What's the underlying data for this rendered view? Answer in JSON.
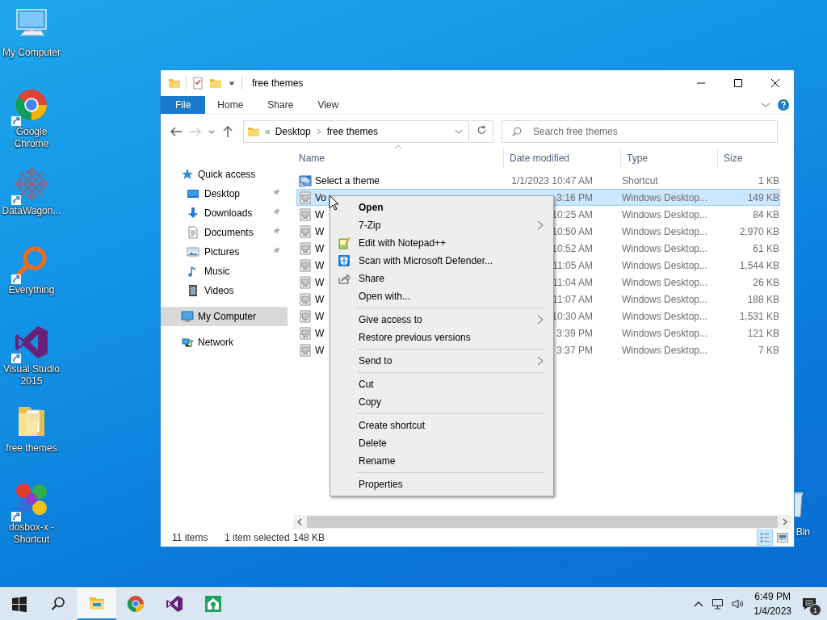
{
  "desktop_icons": [
    {
      "label": "My Computer",
      "kind": "computer",
      "shortcut": false
    },
    {
      "label": "Google Chrome",
      "kind": "chrome",
      "shortcut": true
    },
    {
      "label": "DataWagon...",
      "kind": "datawagon",
      "shortcut": true
    },
    {
      "label": "Everything",
      "kind": "everything",
      "shortcut": true
    },
    {
      "label": "Visual Studio 2015",
      "kind": "vs",
      "shortcut": true
    },
    {
      "label": "free themes",
      "kind": "themes_folder",
      "shortcut": false
    },
    {
      "label": "dosbox-x - Shortcut",
      "kind": "dosbox",
      "shortcut": true
    }
  ],
  "recycle_bin": {
    "label": "Bin"
  },
  "window": {
    "title": "free themes",
    "ribbon_tabs": [
      {
        "label": "File",
        "selected": true
      },
      {
        "label": "Home",
        "selected": false
      },
      {
        "label": "Share",
        "selected": false
      },
      {
        "label": "View",
        "selected": false
      }
    ],
    "address": {
      "overflow": "«",
      "breadcrumb": [
        "Desktop",
        "free themes"
      ]
    },
    "search": {
      "placeholder": "Search free themes"
    },
    "nav_pane": [
      {
        "label": "Quick access",
        "kind": "star",
        "selected": false,
        "children": [
          {
            "label": "Desktop",
            "kind": "desktop",
            "pinned": true,
            "selected": false
          },
          {
            "label": "Downloads",
            "kind": "download",
            "pinned": true,
            "selected": false
          },
          {
            "label": "Documents",
            "kind": "document",
            "pinned": true,
            "selected": false
          },
          {
            "label": "Pictures",
            "kind": "pictures",
            "pinned": true,
            "selected": false
          },
          {
            "label": "Music",
            "kind": "music",
            "pinned": false,
            "selected": false
          },
          {
            "label": "Videos",
            "kind": "videos",
            "pinned": false,
            "selected": false
          }
        ]
      },
      {
        "label": "My Computer",
        "kind": "computer",
        "selected": true
      },
      {
        "label": "Network",
        "kind": "network",
        "selected": false
      }
    ],
    "columns": [
      {
        "label": "Name",
        "sorted": true
      },
      {
        "label": "Date modified",
        "sorted": false
      },
      {
        "label": "Type",
        "sorted": false
      },
      {
        "label": "Size",
        "sorted": false
      }
    ],
    "rows": [
      {
        "kind": "shortcut",
        "name": "Select a theme",
        "date": "1/1/2023 10:47 AM",
        "type": "Shortcut",
        "size": "1 KB",
        "selected": false
      },
      {
        "kind": "theme",
        "name": "Vo",
        "date": "3:16 PM",
        "type": "Windows Desktop...",
        "size": "149 KB",
        "selected": true
      },
      {
        "kind": "theme",
        "name": "W",
        "date": "10:25 AM",
        "type": "Windows Desktop...",
        "size": "84 KB",
        "selected": false
      },
      {
        "kind": "theme",
        "name": "W",
        "date": "10:50 AM",
        "type": "Windows Desktop...",
        "size": "2,970 KB",
        "selected": false
      },
      {
        "kind": "theme",
        "name": "W",
        "date": "10:52 AM",
        "type": "Windows Desktop...",
        "size": "61 KB",
        "selected": false
      },
      {
        "kind": "theme",
        "name": "W",
        "date": "11:05 AM",
        "type": "Windows Desktop...",
        "size": "1,544 KB",
        "selected": false
      },
      {
        "kind": "theme",
        "name": "W",
        "date": "11:04 AM",
        "type": "Windows Desktop...",
        "size": "26 KB",
        "selected": false
      },
      {
        "kind": "theme",
        "name": "W",
        "date": "11:07 AM",
        "type": "Windows Desktop...",
        "size": "188 KB",
        "selected": false
      },
      {
        "kind": "theme",
        "name": "W",
        "date": "10:30 AM",
        "type": "Windows Desktop...",
        "size": "1,531 KB",
        "selected": false
      },
      {
        "kind": "theme",
        "name": "W",
        "date": "3:39 PM",
        "type": "Windows Desktop...",
        "size": "121 KB",
        "selected": false
      },
      {
        "kind": "theme",
        "name": "W",
        "date": "3:37 PM",
        "type": "Windows Desktop...",
        "size": "7 KB",
        "selected": false
      }
    ],
    "status_bar": {
      "item_count": "11 items",
      "selection": "1 item selected",
      "size": "148 KB"
    },
    "views": [
      {
        "kind": "details",
        "selected": true
      },
      {
        "kind": "large_icons",
        "selected": false
      }
    ]
  },
  "context_menu": {
    "groups": [
      [
        {
          "label": "Open",
          "default": true,
          "submenu": false
        },
        {
          "label": "7-Zip",
          "default": false,
          "submenu": true
        },
        {
          "label": "Edit with Notepad++",
          "kind": "notepad",
          "default": false,
          "submenu": false
        },
        {
          "label": "Scan with Microsoft Defender...",
          "kind": "defender",
          "default": false,
          "submenu": false
        },
        {
          "label": "Share",
          "kind": "share",
          "default": false,
          "submenu": false
        },
        {
          "label": "Open with...",
          "default": false,
          "submenu": false
        }
      ],
      [
        {
          "label": "Give access to",
          "default": false,
          "submenu": true
        },
        {
          "label": "Restore previous versions",
          "default": false,
          "submenu": false
        }
      ],
      [
        {
          "label": "Send to",
          "default": false,
          "submenu": true
        }
      ],
      [
        {
          "label": "Cut",
          "default": false,
          "submenu": false
        },
        {
          "label": "Copy",
          "default": false,
          "submenu": false
        }
      ],
      [
        {
          "label": "Create shortcut",
          "default": false,
          "submenu": false
        },
        {
          "label": "Delete",
          "default": false,
          "submenu": false
        },
        {
          "label": "Rename",
          "default": false,
          "submenu": false
        }
      ],
      [
        {
          "label": "Properties",
          "default": false,
          "submenu": false
        }
      ]
    ]
  },
  "taskbar": {
    "apps": [
      {
        "kind": "explorer",
        "active": true
      },
      {
        "kind": "chrome",
        "active": false
      },
      {
        "kind": "vs",
        "active": false
      },
      {
        "kind": "greenapp",
        "active": false
      }
    ],
    "clock": {
      "time": "6:49 PM",
      "date": "1/4/2023"
    },
    "notifications": "1"
  }
}
